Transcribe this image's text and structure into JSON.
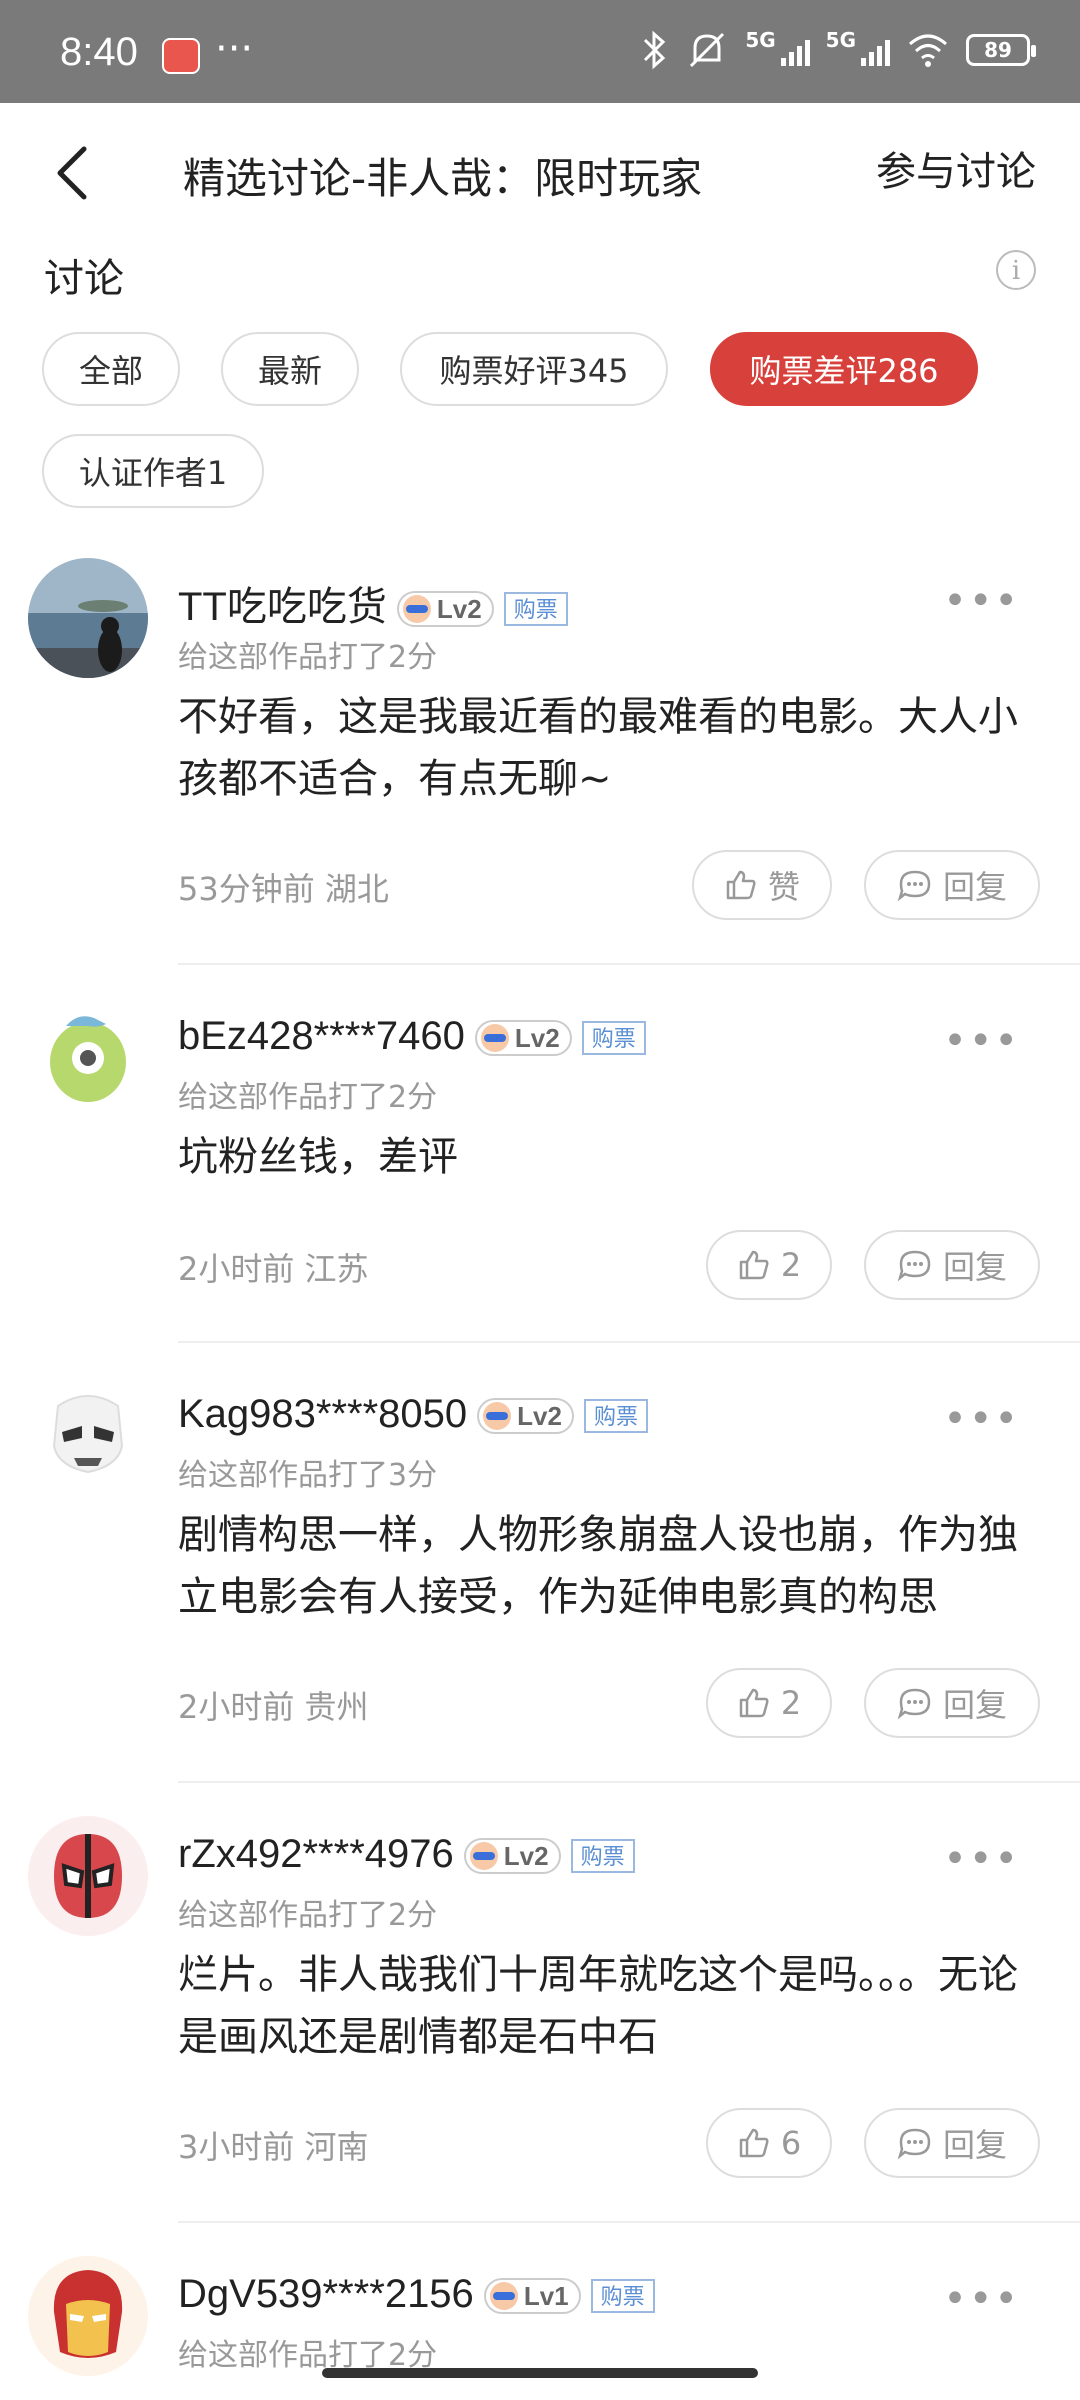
{
  "status_bar": {
    "time": "8:40",
    "dots": "···",
    "net1": "5G",
    "net2": "5G",
    "battery": "89"
  },
  "header": {
    "title": "精选讨论-非人哉：限时玩家",
    "join_label": "参与讨论"
  },
  "section_label": "讨论",
  "info_glyph": "i",
  "filters": [
    {
      "label": "全部"
    },
    {
      "label": "最新"
    },
    {
      "label": "购票好评345"
    },
    {
      "label": "购票差评286",
      "active": true
    },
    {
      "label": "认证作者1"
    }
  ],
  "colors": {
    "accent": "#d8403b"
  },
  "comments": [
    {
      "username": "TT吃吃吃货",
      "level": "Lv2",
      "badge": "购票",
      "score": "给这部作品打了2分",
      "text": "不好看，这是我最近看的最难看的电影。大人小孩都不适合，有点无聊~",
      "time_loc": "53分钟前  湖北",
      "like": "赞",
      "reply": "回复"
    },
    {
      "username": "bEz428****7460",
      "level": "Lv2",
      "badge": "购票",
      "score": "给这部作品打了2分",
      "text": "坑粉丝钱，差评",
      "time_loc": "2小时前  江苏",
      "like": "2",
      "reply": "回复"
    },
    {
      "username": "Kag983****8050",
      "level": "Lv2",
      "badge": "购票",
      "score": "给这部作品打了3分",
      "text": "剧情构思一样，人物形象崩盘人设也崩，作为独立电影会有人接受，作为延伸电影真的构思",
      "time_loc": "2小时前  贵州",
      "like": "2",
      "reply": "回复"
    },
    {
      "username": "rZx492****4976",
      "level": "Lv2",
      "badge": "购票",
      "score": "给这部作品打了2分",
      "text": "烂片。非人哉我们十周年就吃这个是吗。。。无论是画风还是剧情都是石中石",
      "time_loc": "3小时前  河南",
      "like": "6",
      "reply": "回复"
    },
    {
      "username": "DgV539****2156",
      "level": "Lv1",
      "badge": "购票",
      "score": "给这部作品打了2分"
    }
  ]
}
